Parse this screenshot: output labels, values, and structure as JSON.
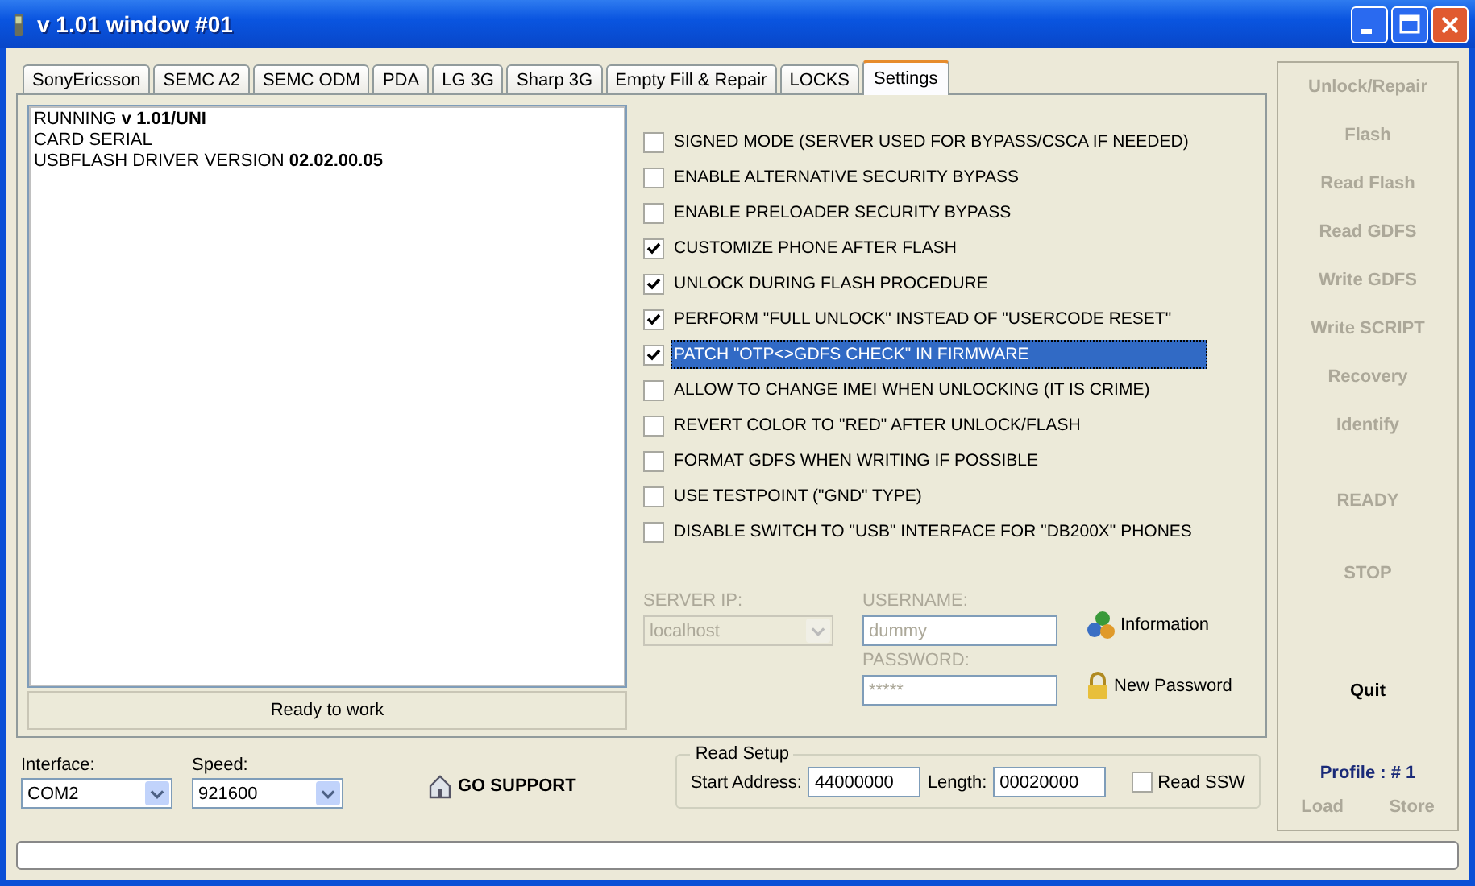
{
  "window": {
    "title": "v 1.01 window #01"
  },
  "tabs": [
    {
      "label": "SonyEricsson",
      "selected": false
    },
    {
      "label": "SEMC A2",
      "selected": false
    },
    {
      "label": "SEMC ODM",
      "selected": false
    },
    {
      "label": "PDA",
      "selected": false
    },
    {
      "label": "LG 3G",
      "selected": false
    },
    {
      "label": "Sharp 3G",
      "selected": false
    },
    {
      "label": "Empty Fill & Repair",
      "selected": false
    },
    {
      "label": "LOCKS",
      "selected": false
    },
    {
      "label": "Settings",
      "selected": true
    }
  ],
  "log": {
    "lines": [
      "RUNNING **v 1.01/UNI**",
      "CARD SERIAL",
      "USBFLASH DRIVER VERSION **02.02.00.05**"
    ],
    "status": "Ready to work"
  },
  "options": [
    {
      "label": "SIGNED MODE (SERVER USED FOR BYPASS/CSCA IF NEEDED)",
      "checked": false,
      "selected": false
    },
    {
      "label": "ENABLE ALTERNATIVE SECURITY BYPASS",
      "checked": false,
      "selected": false
    },
    {
      "label": "ENABLE PRELOADER SECURITY BYPASS",
      "checked": false,
      "selected": false
    },
    {
      "label": "CUSTOMIZE PHONE AFTER FLASH",
      "checked": true,
      "selected": false
    },
    {
      "label": "UNLOCK DURING FLASH PROCEDURE",
      "checked": true,
      "selected": false
    },
    {
      "label": "PERFORM \"FULL UNLOCK\" INSTEAD OF \"USERCODE RESET\"",
      "checked": true,
      "selected": false
    },
    {
      "label": "PATCH \"OTP<>GDFS CHECK\" IN FIRMWARE",
      "checked": true,
      "selected": true
    },
    {
      "label": "ALLOW TO CHANGE IMEI WHEN UNLOCKING (IT IS CRIME)",
      "checked": false,
      "selected": false
    },
    {
      "label": "REVERT COLOR TO \"RED\" AFTER UNLOCK/FLASH",
      "checked": false,
      "selected": false
    },
    {
      "label": "FORMAT GDFS WHEN WRITING IF POSSIBLE",
      "checked": false,
      "selected": false
    },
    {
      "label": "USE TESTPOINT (\"GND\" TYPE)",
      "checked": false,
      "selected": false
    },
    {
      "label": "DISABLE SWITCH TO \"USB\" INTERFACE FOR \"DB200X\" PHONES",
      "checked": false,
      "selected": false
    }
  ],
  "server": {
    "server_ip": {
      "label": "SERVER IP:",
      "value": "localhost",
      "disabled": true
    },
    "username": {
      "label": "USERNAME:",
      "placeholder": "dummy"
    },
    "password": {
      "label": "PASSWORD:",
      "placeholder": "*****"
    },
    "information": "Information",
    "new_password": "New Password"
  },
  "interface": {
    "label": "Interface:",
    "value": "COM2"
  },
  "speed": {
    "label": "Speed:",
    "value": "921600"
  },
  "go_support": "GO SUPPORT",
  "read_setup": {
    "title": "Read Setup",
    "start_label": "Start Address:",
    "start_value": "44000000",
    "length_label": "Length:",
    "length_value": "00020000",
    "read_ssw": {
      "label": "Read SSW",
      "checked": false
    }
  },
  "actions": [
    {
      "label": "Unlock/Repair",
      "disabled": true
    },
    {
      "label": "Flash",
      "disabled": true
    },
    {
      "label": "Read Flash",
      "disabled": true
    },
    {
      "label": "Read GDFS",
      "disabled": true
    },
    {
      "label": "Write GDFS",
      "disabled": true
    },
    {
      "label": "Write SCRIPT",
      "disabled": true
    },
    {
      "label": "Recovery",
      "disabled": true
    },
    {
      "label": "Identify",
      "disabled": true
    }
  ],
  "status_buttons": [
    {
      "label": "READY",
      "disabled": true
    },
    {
      "label": "STOP",
      "disabled": true
    }
  ],
  "quit": {
    "label": "Quit",
    "disabled": false
  },
  "profile": {
    "label": "Profile : # 1",
    "load": {
      "label": "Load",
      "disabled": true
    },
    "store": {
      "label": "Store",
      "disabled": true
    }
  },
  "progress": {
    "level": 0
  }
}
